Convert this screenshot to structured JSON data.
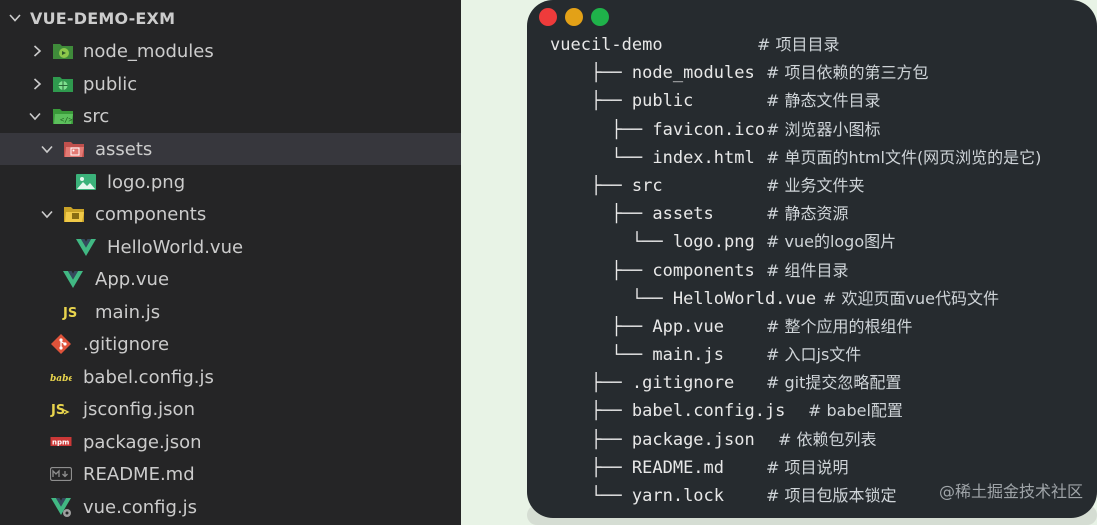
{
  "explorer": {
    "project_title": "VUE-DEMO-EXM",
    "items": [
      {
        "label": "node_modules",
        "icon": "node-modules-folder-icon",
        "expanded": false
      },
      {
        "label": "public",
        "icon": "public-folder-icon",
        "expanded": false
      },
      {
        "label": "src",
        "icon": "src-folder-icon",
        "expanded": true
      },
      {
        "label": "assets",
        "icon": "assets-folder-icon",
        "expanded": true,
        "selected": true
      },
      {
        "label": "logo.png",
        "icon": "image-file-icon"
      },
      {
        "label": "components",
        "icon": "components-folder-icon",
        "expanded": true
      },
      {
        "label": "HelloWorld.vue",
        "icon": "vue-file-icon"
      },
      {
        "label": "App.vue",
        "icon": "vue-file-icon"
      },
      {
        "label": "main.js",
        "icon": "js-file-icon"
      },
      {
        "label": ".gitignore",
        "icon": "git-file-icon"
      },
      {
        "label": "babel.config.js",
        "icon": "babel-file-icon"
      },
      {
        "label": "jsconfig.json",
        "icon": "json-file-icon"
      },
      {
        "label": "package.json",
        "icon": "npm-file-icon"
      },
      {
        "label": "README.md",
        "icon": "markdown-file-icon"
      },
      {
        "label": "vue.config.js",
        "icon": "vue-config-file-icon"
      }
    ]
  },
  "window_controls": {
    "close_color": "#ee3b3b",
    "minimize_color": "#e3a117",
    "maximize_color": "#1fb24a"
  },
  "tree": {
    "lines": [
      {
        "prefix": "",
        "name": "vuecil-demo",
        "comment": "# 项目目录"
      },
      {
        "prefix": "    ├── ",
        "name": "node_modules",
        "comment": "# 项目依赖的第三方包"
      },
      {
        "prefix": "    ├── ",
        "name": "public",
        "comment": "# 静态文件目录"
      },
      {
        "prefix": "      ├── ",
        "name": "favicon.ico",
        "comment": "# 浏览器小图标"
      },
      {
        "prefix": "      └── ",
        "name": "index.html",
        "comment": "# 单页面的html文件(网页浏览的是它)"
      },
      {
        "prefix": "    ├── ",
        "name": "src",
        "comment": "# 业务文件夹"
      },
      {
        "prefix": "      ├── ",
        "name": "assets",
        "comment": "# 静态资源"
      },
      {
        "prefix": "        └── ",
        "name": "logo.png",
        "comment": "# vue的logo图片"
      },
      {
        "prefix": "      ├── ",
        "name": "components",
        "comment": "# 组件目录"
      },
      {
        "prefix": "        └── ",
        "name": "HelloWorld.vue",
        "comment": "# 欢迎页面vue代码文件"
      },
      {
        "prefix": "      ├── ",
        "name": "App.vue",
        "comment": "# 整个应用的根组件"
      },
      {
        "prefix": "      └── ",
        "name": "main.js",
        "comment": "# 入口js文件"
      },
      {
        "prefix": "    ├── ",
        "name": ".gitignore",
        "comment": "# git提交忽略配置"
      },
      {
        "prefix": "    ├── ",
        "name": "babel.config.js",
        "comment": "# babel配置"
      },
      {
        "prefix": "    ├── ",
        "name": "package.json",
        "comment": "# 依赖包列表"
      },
      {
        "prefix": "    ├── ",
        "name": "README.md",
        "comment": "# 项目说明"
      },
      {
        "prefix": "    └── ",
        "name": "yarn.lock",
        "comment": "# 项目包版本锁定"
      }
    ]
  },
  "watermark": "@稀土掘金技术社区"
}
